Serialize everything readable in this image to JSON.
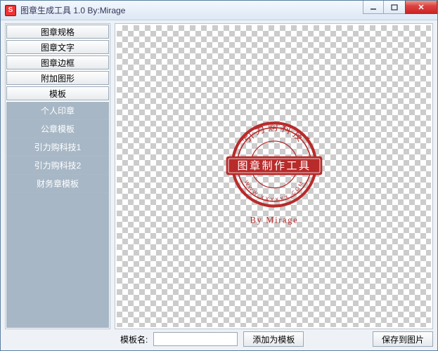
{
  "window": {
    "title": "图章生成工具 1.0   By:Mirage"
  },
  "sidebar": {
    "sections": [
      {
        "label": "图章规格"
      },
      {
        "label": "图章文字"
      },
      {
        "label": "图章边框"
      },
      {
        "label": "附加图形"
      },
      {
        "label": "模板"
      }
    ],
    "templates": [
      {
        "label": "个人印章"
      },
      {
        "label": "公章模板"
      },
      {
        "label": "引力购科技1"
      },
      {
        "label": "引力购科技2"
      },
      {
        "label": "财务章模板"
      }
    ]
  },
  "seal": {
    "top_text": "引力购科技",
    "banner_text": "图章制作工具",
    "bottom_text": "WWW.XXXXXX.COM",
    "author": "By Mirage",
    "color": "#b82b2b"
  },
  "bottom": {
    "template_name_label": "模板名:",
    "template_name_value": "",
    "add_template_btn": "添加为模板",
    "save_image_btn": "保存到图片"
  }
}
